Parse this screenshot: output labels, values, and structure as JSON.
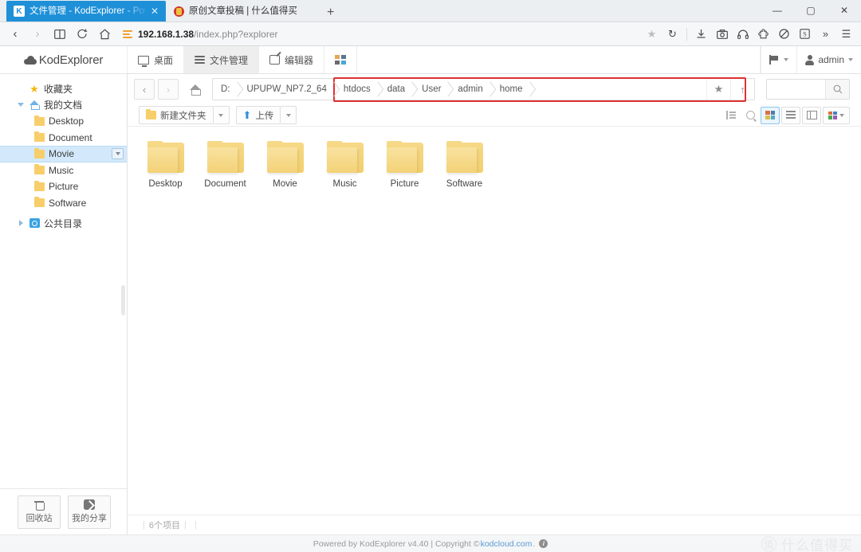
{
  "browser": {
    "tabs": [
      {
        "title": "文件管理 - KodExplorer - Powered by",
        "favicon": "kodexplorer-favicon",
        "active": true,
        "close_label": "✕"
      },
      {
        "title": "原创文章投稿 | 什么值得买",
        "favicon": "smzdm-favicon",
        "active": false,
        "close_label": ""
      }
    ],
    "newtab_label": "+",
    "window_controls": {
      "minimize": "—",
      "maximize": "▢",
      "close": "✕"
    },
    "nav": {
      "back": "‹",
      "forward": "›",
      "bookmarks": "📖",
      "history": "↺",
      "home": "⌂"
    },
    "url": {
      "host": "192.168.1.38",
      "path": "/index.php?explorer"
    },
    "toolbar_icons": [
      "star-icon",
      "reload-icon",
      "download-icon",
      "screenshot-icon",
      "headphone-icon",
      "extension-icon",
      "privacy-icon",
      "s-badge-icon",
      "overflow-icon",
      "menu-icon"
    ]
  },
  "kod": {
    "logo": "KodExplorer",
    "nav": [
      {
        "label": "桌面",
        "icon": "monitor-icon",
        "active": false
      },
      {
        "label": "文件管理",
        "icon": "files-icon",
        "active": true
      },
      {
        "label": "编辑器",
        "icon": "pencil-icon",
        "active": false
      },
      {
        "label": "",
        "icon": "apps-grid-icon",
        "active": false
      }
    ],
    "right": {
      "flag_label": "",
      "user_label": "admin"
    }
  },
  "sidebar": {
    "items": [
      {
        "label": "收藏夹",
        "icon": "star-icon",
        "indent": 1,
        "twisty": "none",
        "selected": false
      },
      {
        "label": "我的文档",
        "icon": "home-icon",
        "indent": 1,
        "twisty": "down",
        "selected": false
      },
      {
        "label": "Desktop",
        "icon": "folder-icon",
        "indent": 2,
        "twisty": "none",
        "selected": false
      },
      {
        "label": "Document",
        "icon": "folder-icon",
        "indent": 2,
        "twisty": "none",
        "selected": false
      },
      {
        "label": "Movie",
        "icon": "folder-icon",
        "indent": 2,
        "twisty": "none",
        "selected": true
      },
      {
        "label": "Music",
        "icon": "folder-icon",
        "indent": 2,
        "twisty": "none",
        "selected": false
      },
      {
        "label": "Picture",
        "icon": "folder-icon",
        "indent": 2,
        "twisty": "none",
        "selected": false
      },
      {
        "label": "Software",
        "icon": "folder-icon",
        "indent": 2,
        "twisty": "none",
        "selected": false
      },
      {
        "label": "公共目录",
        "icon": "blue-disk-icon",
        "indent": 1,
        "twisty": "right",
        "selected": false
      }
    ],
    "footer": [
      {
        "label": "回收站",
        "icon": "trash-icon"
      },
      {
        "label": "我的分享",
        "icon": "share-icon"
      }
    ]
  },
  "pathbar": {
    "back": "‹",
    "forward": "›",
    "home_icon": "home-icon",
    "crumbs": [
      "D:",
      "UPUPW_NP7.2_64",
      "htdocs",
      "data",
      "User",
      "admin",
      "home"
    ],
    "favorite_icon": "★",
    "up_icon": "↑",
    "highlight_color": "#e03131"
  },
  "search": {
    "value": "",
    "placeholder": "",
    "icon": "magnifier-icon"
  },
  "toolbar": {
    "new_folder_label": "新建文件夹",
    "upload_label": "上传",
    "dropdown_caret": "▾",
    "view_icons": [
      {
        "name": "sort-icon",
        "boxed": false,
        "active": false
      },
      {
        "name": "zoom-icon",
        "boxed": false,
        "active": false
      },
      {
        "name": "thumbnail-view-icon",
        "boxed": true,
        "active": true
      },
      {
        "name": "list-view-icon",
        "boxed": true,
        "active": false
      },
      {
        "name": "column-view-icon",
        "boxed": true,
        "active": false
      },
      {
        "name": "theme-icon",
        "boxed": true,
        "active": false
      }
    ]
  },
  "files": [
    {
      "name": "Desktop",
      "type": "folder"
    },
    {
      "name": "Document",
      "type": "folder"
    },
    {
      "name": "Movie",
      "type": "folder"
    },
    {
      "name": "Music",
      "type": "folder"
    },
    {
      "name": "Picture",
      "type": "folder"
    },
    {
      "name": "Software",
      "type": "folder"
    }
  ],
  "status": {
    "count_label": "6个项目"
  },
  "footer": {
    "powered": "Powered by KodExplorer v4.40 | Copyright © ",
    "link": "kodcloud.com",
    "link_suffix": ".",
    "info_icon": "i"
  },
  "watermark": {
    "mark": "值",
    "text": "什么值得买"
  }
}
